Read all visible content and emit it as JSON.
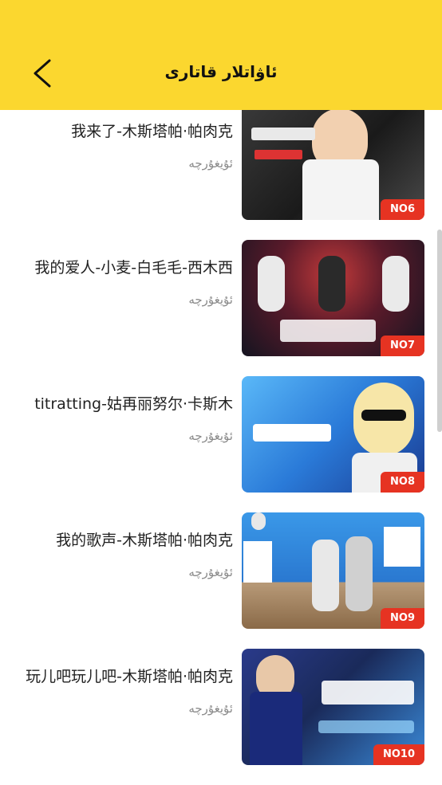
{
  "header": {
    "title": "ئاۋاتلار قاتارى",
    "back_icon": "chevron-left-icon"
  },
  "songs": [
    {
      "title": "我来了-木斯塔帕·帕肉克",
      "lang": "ئۇيغۇرچە",
      "rank": "NO6",
      "thumb_colors": [
        "#2a2a2a",
        "#ffffff"
      ]
    },
    {
      "title": "我的爱人-小麦-白毛毛-西木西",
      "lang": "ئۇيغۇرچە",
      "rank": "NO7",
      "thumb_colors": [
        "#6a1a2a",
        "#1a1a2a"
      ]
    },
    {
      "title": "titratting-姑再丽努尔·卡斯木",
      "lang": "ئۇيغۇرچە",
      "rank": "NO8",
      "thumb_colors": [
        "#3aa0f0",
        "#1a4ab0"
      ]
    },
    {
      "title": "我的歌声-木斯塔帕·帕肉克",
      "lang": "ئۇيغۇرچە",
      "rank": "NO9",
      "thumb_colors": [
        "#2a7ad0",
        "#c7a882"
      ]
    },
    {
      "title": "玩儿吧玩儿吧-木斯塔帕·帕肉克",
      "lang": "ئۇيغۇرچە",
      "rank": "NO10",
      "thumb_colors": [
        "#1a2a6a",
        "#3a8ad8"
      ]
    }
  ],
  "colors": {
    "header_bg": "#fbd72f",
    "rank_bg": "#e63322"
  }
}
